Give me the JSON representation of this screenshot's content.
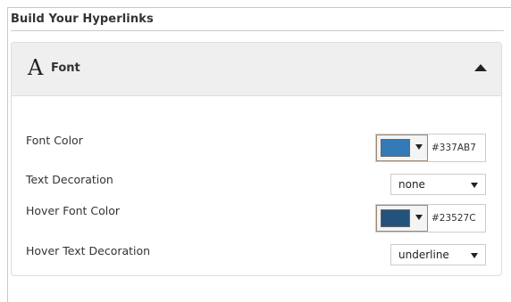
{
  "section": {
    "title": "Build Your Hyperlinks"
  },
  "panel": {
    "icon_glyph": "A",
    "icon": "font-serif-A-icon",
    "title": "Font",
    "toggle_icon": "caret-up-icon",
    "expanded": true
  },
  "fields": {
    "font_color": {
      "label": "Font Color",
      "swatch_color": "#337AB7",
      "hex_value": "#337AB7"
    },
    "text_decoration": {
      "label": "Text Decoration",
      "selected": "none"
    },
    "hover_font_color": {
      "label": "Hover Font Color",
      "swatch_color": "#23527C",
      "hex_value": "#23527C"
    },
    "hover_text_decoration": {
      "label": "Hover Text Decoration",
      "selected": "underline"
    }
  }
}
